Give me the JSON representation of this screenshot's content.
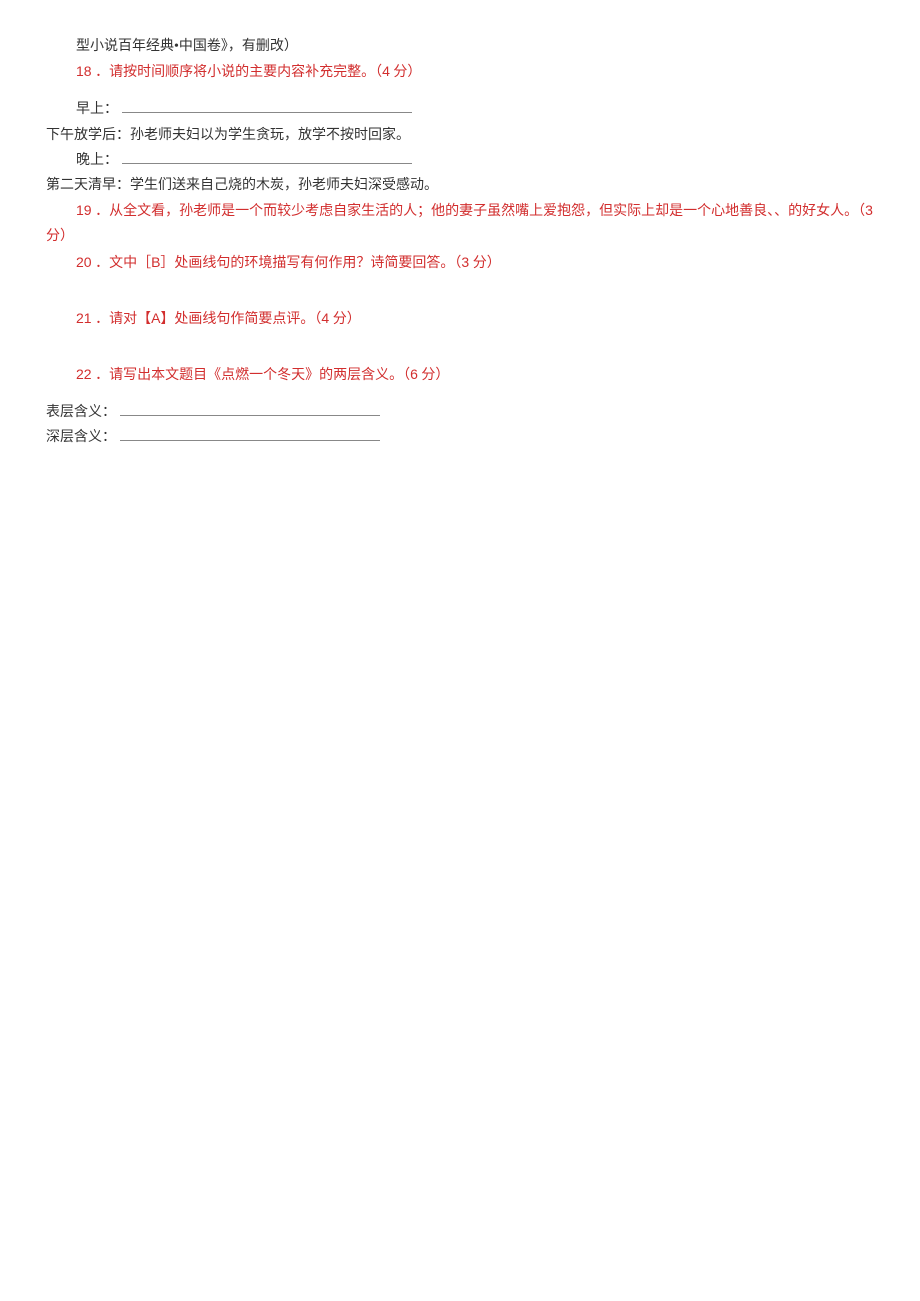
{
  "lines": {
    "l0": "型小说百年经典•中国卷》，有删改）",
    "q18_num": "18",
    "q18_text": "．请按时间顺序将小说的主要内容补充完整。（",
    "q18_pts_num": "4",
    "q18_pts_tail": " 分）",
    "morning_label": "早上：",
    "afternoon": "下午放学后：孙老师夫妇以为学生贪玩，放学不按时回家。",
    "evening_label": "晚上：",
    "nextday": "第二天清早：学生们送来自己烧的木炭，孙老师夫妇深受感动。",
    "q19_num": "19",
    "q19_text_a": "．从全文看，孙老师是一个而较少考虑自家生活的人；他的妻子虽然嘴上爱抱怨，但实际上却是一个心地善良、、的好女人。（",
    "q19_pts_num": "3",
    "q19_tail": "分）",
    "q20_num": "20",
    "q20_text_a": "．文中［",
    "q20_b": "B",
    "q20_text_b": "］处画线句的环境描写有何作用？诗简要回答。（",
    "q20_pts_num": "3",
    "q20_pts_tail": " 分）",
    "q21_num": "21",
    "q21_text_a": "．请对【",
    "q21_a": "A",
    "q21_text_b": "】处画线句作简要点评。（",
    "q21_pts_num": "4",
    "q21_pts_tail": " 分）",
    "q22_num": "22",
    "q22_text": "．请写出本文题目《点燃一个冬天》的两层含义。（",
    "q22_pts_num": "6",
    "q22_pts_tail": " 分）",
    "surface_label": "表层含义：",
    "deep_label": "深层含义："
  }
}
